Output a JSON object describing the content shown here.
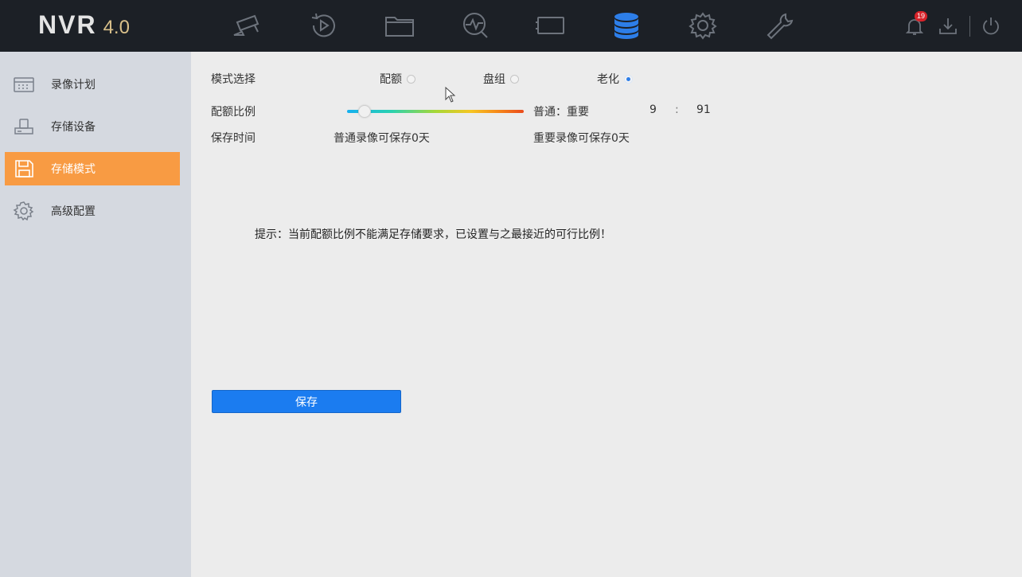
{
  "app": {
    "logo_main": "NVR",
    "logo_version": "4.0",
    "notification_count": "19"
  },
  "nav": [
    {
      "name": "camera-icon",
      "active": false
    },
    {
      "name": "playback-icon",
      "active": false
    },
    {
      "name": "folder-icon",
      "active": false
    },
    {
      "name": "analytics-icon",
      "active": false
    },
    {
      "name": "display-icon",
      "active": false
    },
    {
      "name": "storage-icon",
      "active": true
    },
    {
      "name": "gear-icon",
      "active": false
    },
    {
      "name": "wrench-icon",
      "active": false
    }
  ],
  "sidebar": {
    "items": [
      {
        "label": "录像计划",
        "icon": "calendar-icon",
        "active": false
      },
      {
        "label": "存储设备",
        "icon": "hdd-icon",
        "active": false
      },
      {
        "label": "存储模式",
        "icon": "save-disk-icon",
        "active": true
      },
      {
        "label": "高级配置",
        "icon": "gear-icon",
        "active": false
      }
    ]
  },
  "form": {
    "mode_label": "模式选择",
    "mode_options": [
      {
        "label": "配额",
        "checked": false
      },
      {
        "label": "盘组",
        "checked": false
      },
      {
        "label": "老化",
        "checked": true
      }
    ],
    "ratio_label": "配额比例",
    "ratio_type_label": "普通：重要",
    "ratio_normal": "9",
    "ratio_sep": ":",
    "ratio_important": "91",
    "ratio_slider_fraction": 0.07,
    "save_time_label": "保存时间",
    "normal_save_text": "普通录像可保存0天",
    "important_save_text": "重要录像可保存0天",
    "hint_text": "提示：当前配额比例不能满足存储要求，已设置与之最接近的可行比例！",
    "save_button": "保存"
  },
  "colors": {
    "topbar": "#1c2026",
    "accent_active_nav": "#2d7ee8",
    "sidebar_active": "#f89b43",
    "button": "#1b7cf0"
  }
}
